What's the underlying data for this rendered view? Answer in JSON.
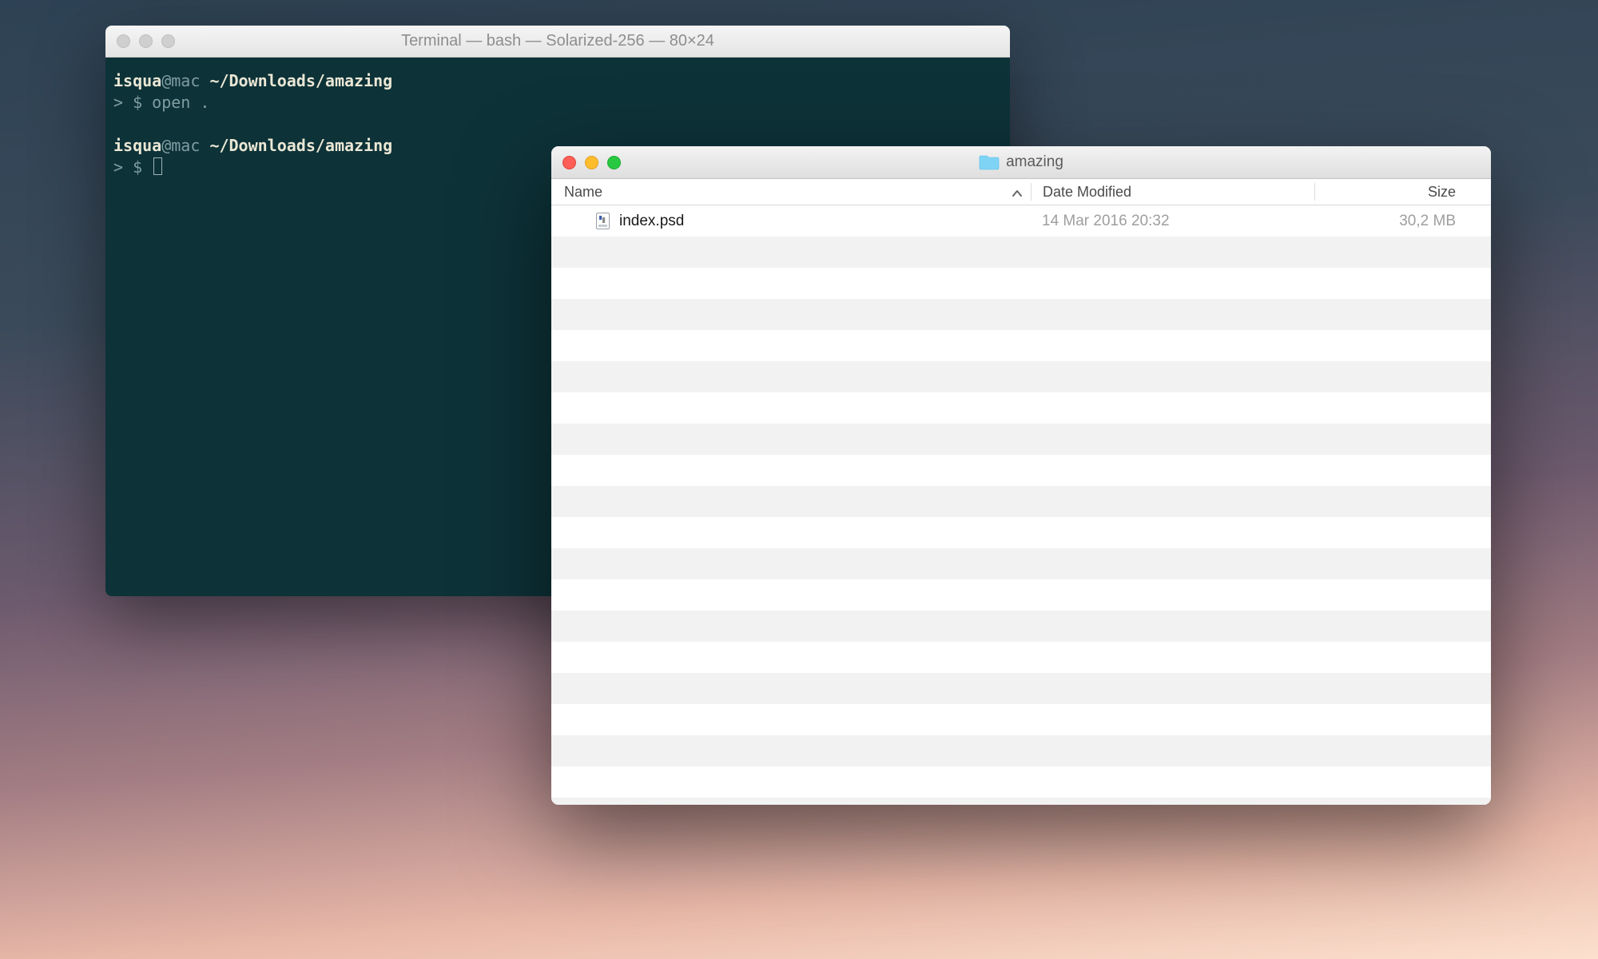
{
  "terminal": {
    "title": "Terminal — bash — Solarized-256 — 80×24",
    "prompt1_user": "isqua",
    "prompt1_at": "@mac ",
    "prompt1_path": "~/Downloads/amazing",
    "prompt1_sym": "> $ ",
    "prompt1_cmd": "open .",
    "prompt2_user": "isqua",
    "prompt2_at": "@mac ",
    "prompt2_path": "~/Downloads/amazing",
    "prompt2_sym": "> $ "
  },
  "finder": {
    "title": "amazing",
    "columns": {
      "name": "Name",
      "date": "Date Modified",
      "size": "Size"
    },
    "rows": [
      {
        "name": "index.psd",
        "date": "14 Mar 2016 20:32",
        "size": "30,2 MB"
      }
    ]
  }
}
